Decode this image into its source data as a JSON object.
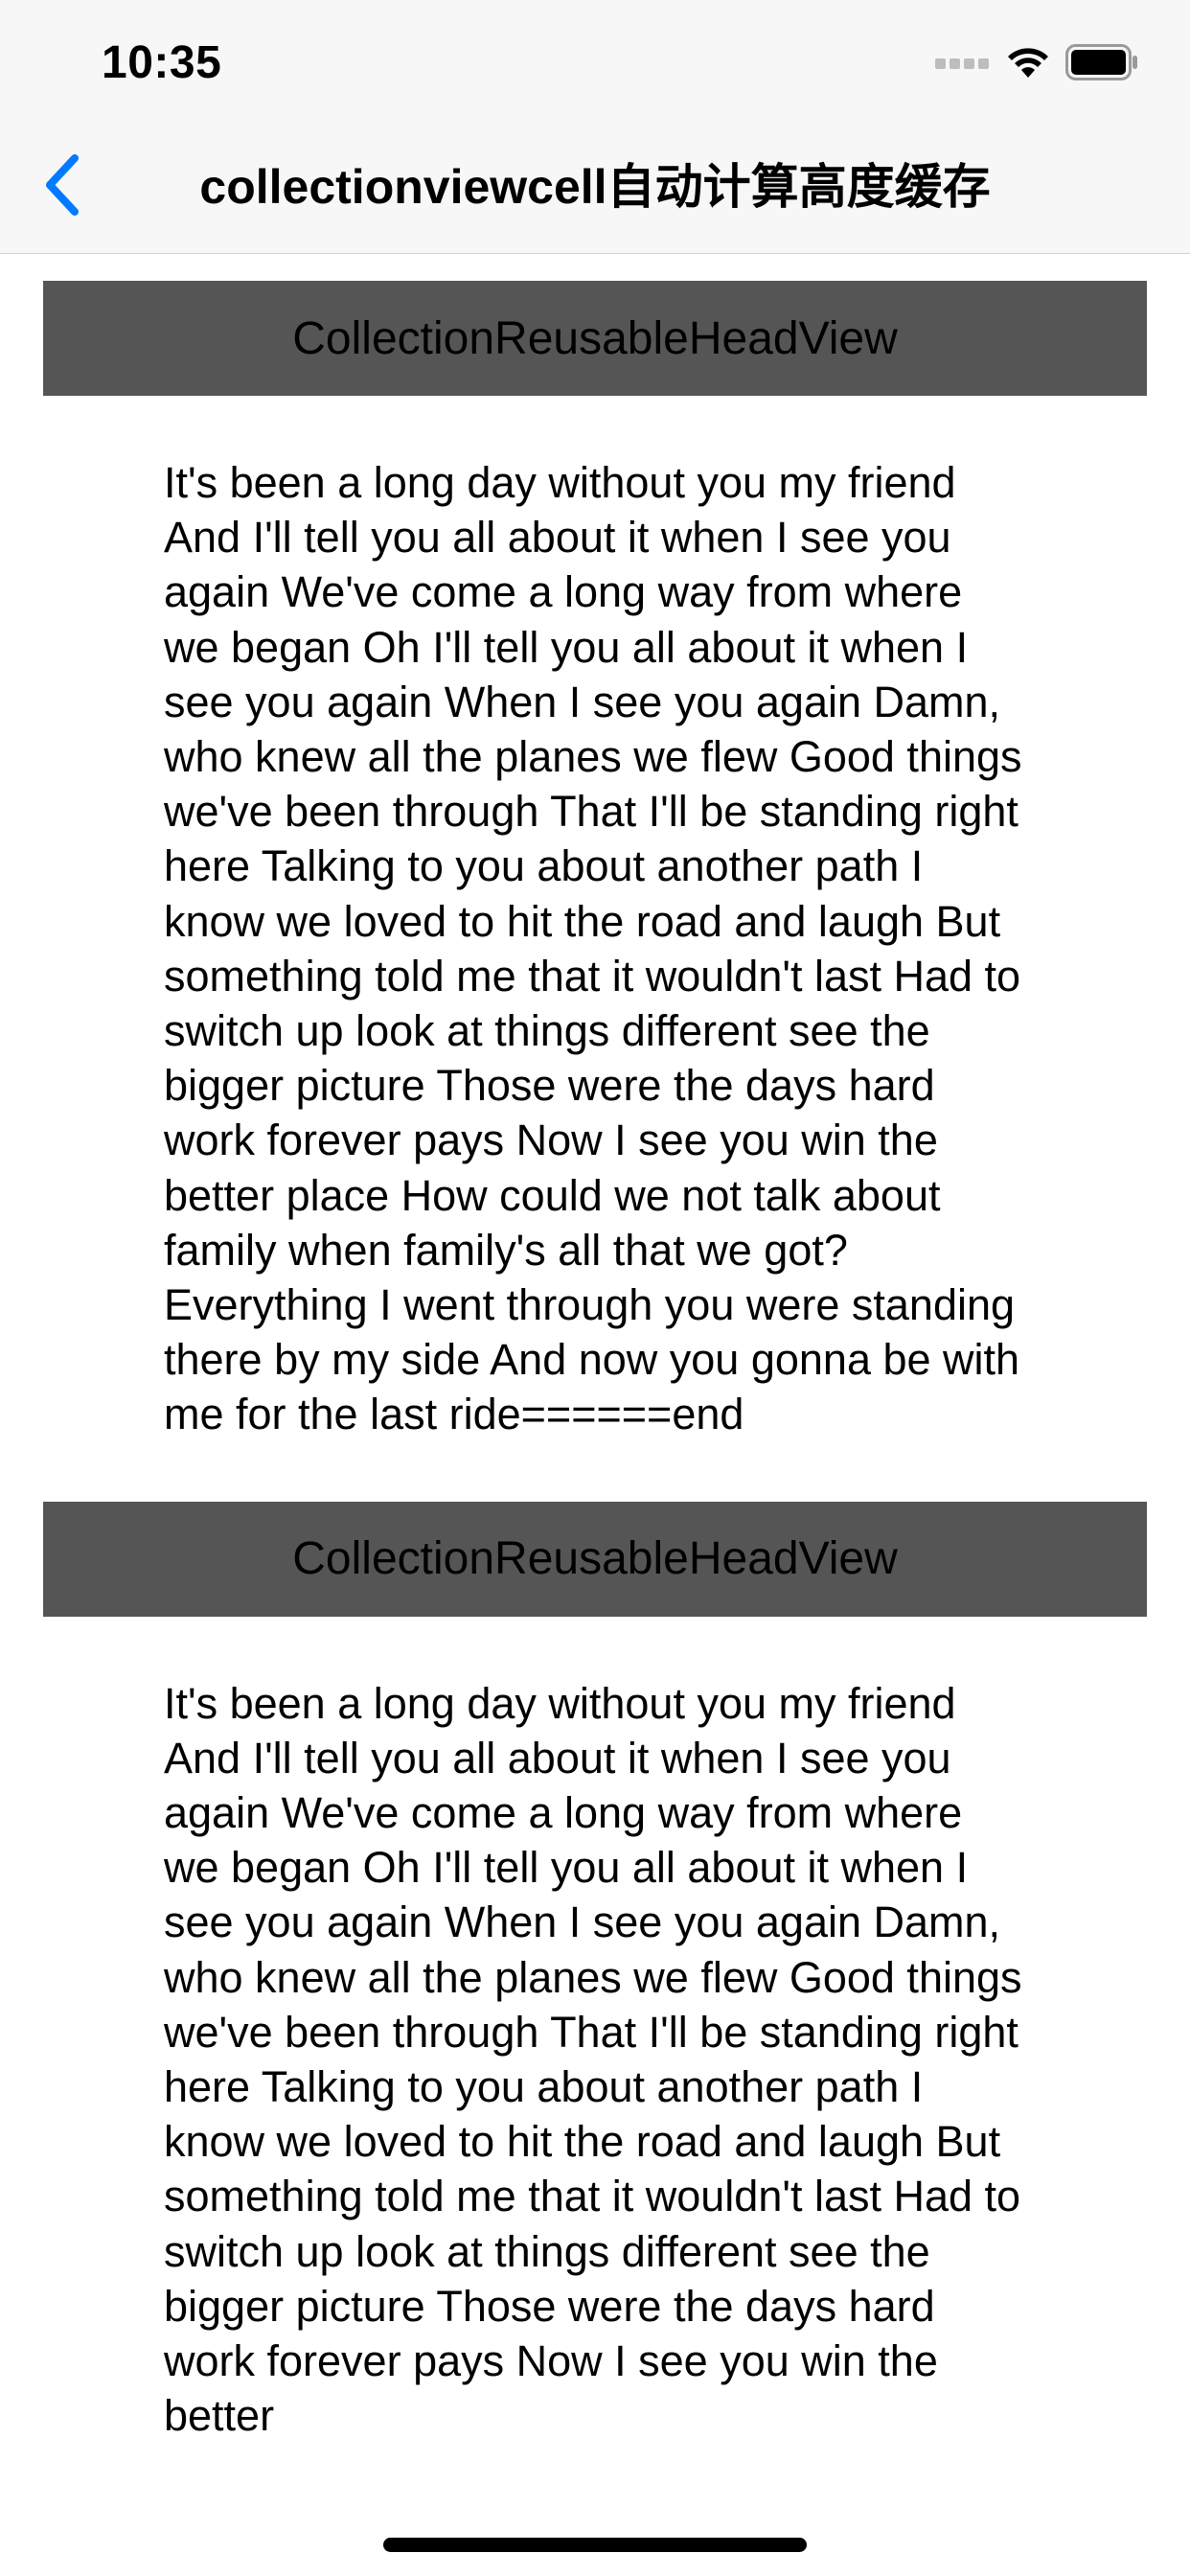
{
  "status_bar": {
    "time": "10:35"
  },
  "nav": {
    "title": "collectionviewcell自动计算高度缓存",
    "back_icon": "chevron-left-icon",
    "accent_color": "#007aff"
  },
  "sections": [
    {
      "header": "CollectionReusableHeadView",
      "cell_text": "It's been a long day without you my friend And I'll tell you all about it when I see you again We've come a long way from where we began Oh I'll tell you all about it when I see you again When I see you again Damn, who knew all the planes we flew Good things we've been through That I'll be standing right here Talking to you about another path I know we loved to hit the road and laugh But something told me that it wouldn't last Had to switch up look at things different see the bigger picture Those were the days hard work forever pays Now I see you win the better place How could we not talk about family when family's all that we got? Everything I went through you were standing there by my side And now you gonna be with me for the last ride======end"
    },
    {
      "header": "CollectionReusableHeadView",
      "cell_text": "It's been a long day without you my friend And I'll tell you all about it when I see you again We've come a long way from where we began Oh I'll tell you all about it when I see you again When I see you again Damn, who knew all the planes we flew Good things we've been through That I'll be standing right here Talking to you about another path I know we loved to hit the road and laugh But something told me that it wouldn't last Had to switch up look at things different see the bigger picture Those were the days hard work forever pays Now I see you win the better"
    }
  ],
  "colors": {
    "header_bg": "#555555",
    "bar_bg": "#f7f7f7"
  }
}
